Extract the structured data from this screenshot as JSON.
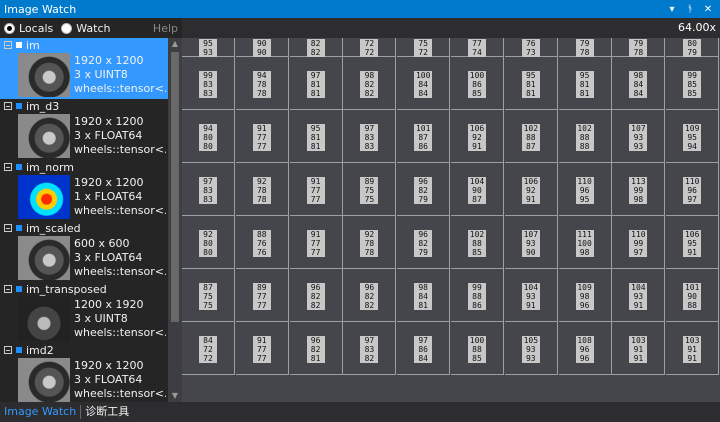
{
  "window": {
    "title": "Image Watch"
  },
  "modes": [
    {
      "label": "Locals",
      "selected": true
    },
    {
      "label": "Watch",
      "selected": false
    }
  ],
  "help_label": "Help",
  "zoom": "64.00x",
  "items": [
    {
      "name": "im",
      "dims": "1920 x 1200",
      "format": "3 x UINT8",
      "type": "wheels::tensor<...",
      "thumb": "wheel",
      "selected": true
    },
    {
      "name": "im_d3",
      "dims": "1920 x 1200",
      "format": "3 x FLOAT64",
      "type": "wheels::tensor<...",
      "thumb": "wheel",
      "selected": false
    },
    {
      "name": "im_norm",
      "dims": "1920 x 1200",
      "format": "1 x FLOAT64",
      "type": "wheels::tensor<...",
      "thumb": "jet",
      "selected": false
    },
    {
      "name": "im_scaled",
      "dims": "600 x 600",
      "format": "3 x FLOAT64",
      "type": "wheels::tensor<...",
      "thumb": "wheel",
      "selected": false
    },
    {
      "name": "im_transposed",
      "dims": "1200 x 1920",
      "format": "3 x UINT8",
      "type": "wheels::tensor<...",
      "thumb": "tall",
      "selected": false
    },
    {
      "name": "imd2",
      "dims": "1920 x 1200",
      "format": "3 x FLOAT64",
      "type": "wheels::tensor<...",
      "thumb": "wheel",
      "selected": false
    }
  ],
  "pixel_grid": [
    [
      [
        "95",
        "93"
      ],
      [
        "90",
        "90"
      ],
      [
        "82",
        "82"
      ],
      [
        "72",
        "72"
      ],
      [
        "75",
        "72"
      ],
      [
        "77",
        "74"
      ],
      [
        "76",
        "73"
      ],
      [
        "79",
        "78"
      ],
      [
        "79",
        "78"
      ],
      [
        "80",
        "79"
      ]
    ],
    [
      [
        "99",
        "83",
        "83"
      ],
      [
        "94",
        "78",
        "78"
      ],
      [
        "97",
        "81",
        "81"
      ],
      [
        "98",
        "82",
        "82"
      ],
      [
        "100",
        "84",
        "84"
      ],
      [
        "100",
        "86",
        "85"
      ],
      [
        "95",
        "81",
        "81"
      ],
      [
        "95",
        "81",
        "81"
      ],
      [
        "98",
        "84",
        "84"
      ],
      [
        "99",
        "85",
        "85"
      ]
    ],
    [
      [
        "94",
        "80",
        "80"
      ],
      [
        "91",
        "77",
        "77"
      ],
      [
        "95",
        "81",
        "81"
      ],
      [
        "97",
        "83",
        "83"
      ],
      [
        "101",
        "87",
        "86"
      ],
      [
        "106",
        "92",
        "91"
      ],
      [
        "102",
        "88",
        "87"
      ],
      [
        "102",
        "88",
        "88"
      ],
      [
        "107",
        "93",
        "93"
      ],
      [
        "109",
        "95",
        "94"
      ]
    ],
    [
      [
        "97",
        "83",
        "83"
      ],
      [
        "92",
        "78",
        "78"
      ],
      [
        "91",
        "77",
        "77"
      ],
      [
        "89",
        "75",
        "75"
      ],
      [
        "96",
        "82",
        "79"
      ],
      [
        "104",
        "90",
        "87"
      ],
      [
        "106",
        "92",
        "91"
      ],
      [
        "110",
        "96",
        "95"
      ],
      [
        "113",
        "99",
        "98"
      ],
      [
        "110",
        "96",
        "97"
      ]
    ],
    [
      [
        "92",
        "80",
        "80"
      ],
      [
        "88",
        "76",
        "76"
      ],
      [
        "91",
        "77",
        "77"
      ],
      [
        "92",
        "78",
        "78"
      ],
      [
        "96",
        "82",
        "79"
      ],
      [
        "102",
        "88",
        "85"
      ],
      [
        "107",
        "93",
        "90"
      ],
      [
        "111",
        "100",
        "98"
      ],
      [
        "110",
        "99",
        "97"
      ],
      [
        "106",
        "95",
        "91"
      ]
    ],
    [
      [
        "87",
        "75",
        "75"
      ],
      [
        "89",
        "77",
        "77"
      ],
      [
        "96",
        "82",
        "82"
      ],
      [
        "96",
        "82",
        "82"
      ],
      [
        "98",
        "84",
        "81"
      ],
      [
        "99",
        "88",
        "86"
      ],
      [
        "104",
        "93",
        "91"
      ],
      [
        "109",
        "98",
        "96"
      ],
      [
        "104",
        "93",
        "91"
      ],
      [
        "101",
        "90",
        "88"
      ]
    ],
    [
      [
        "84",
        "72",
        "72"
      ],
      [
        "91",
        "77",
        "77"
      ],
      [
        "96",
        "82",
        "81"
      ],
      [
        "97",
        "83",
        "82"
      ],
      [
        "97",
        "86",
        "84"
      ],
      [
        "100",
        "88",
        "85"
      ],
      [
        "105",
        "93",
        "93"
      ],
      [
        "108",
        "96",
        "96"
      ],
      [
        "103",
        "91",
        "91"
      ],
      [
        "103",
        "91",
        "91"
      ]
    ]
  ],
  "bottom_tabs": [
    {
      "label": "Image Watch",
      "active": true
    },
    {
      "label": "诊断工具",
      "active": false
    }
  ]
}
